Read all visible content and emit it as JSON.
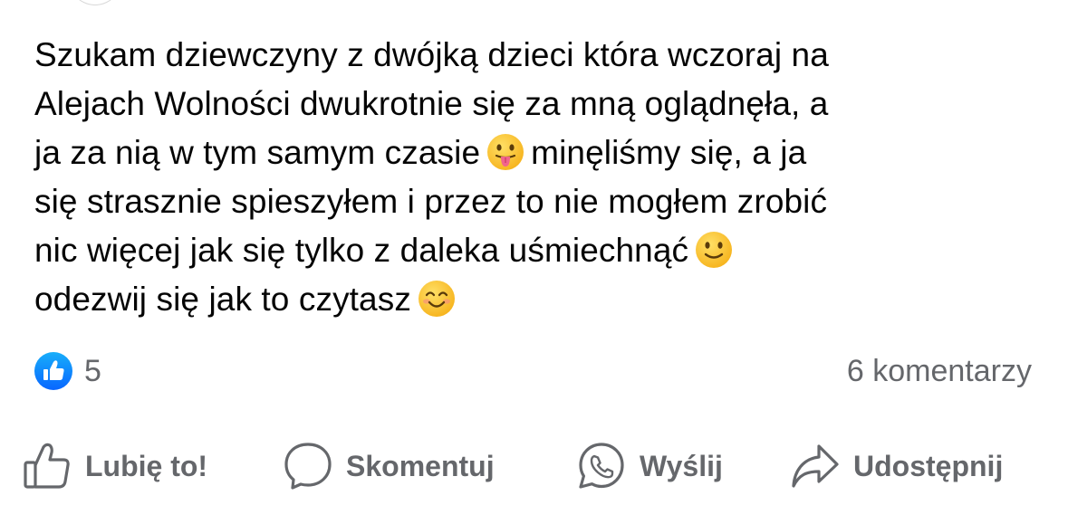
{
  "post": {
    "lines": [
      "Szukam dziewczyny z dwójką dzieci która wczoraj na",
      "Alejach Wolności dwukrotnie się za mną oglądnęła, a",
      "ja za nią w tym samym czasie",
      "minęliśmy się, a ja",
      "się strasznie spieszyłem i przez to nie mogłem zrobić",
      "nic więcej jak się tylko z daleka uśmiechnąć",
      "odezwij się jak to czytasz"
    ],
    "emojis": [
      "tongue-out-emoji",
      "slightly-smiling-emoji",
      "smiling-blush-emoji"
    ]
  },
  "stats": {
    "likes": "5",
    "comments": "6 komentarzy"
  },
  "actions": {
    "like": "Lubię to!",
    "comment": "Skomentuj",
    "send": "Wyślij",
    "share": "Udostępnij"
  },
  "colors": {
    "like_blue": "#1877f2",
    "secondary_text": "#65676b",
    "emoji_yellow": "#fcc21b"
  }
}
